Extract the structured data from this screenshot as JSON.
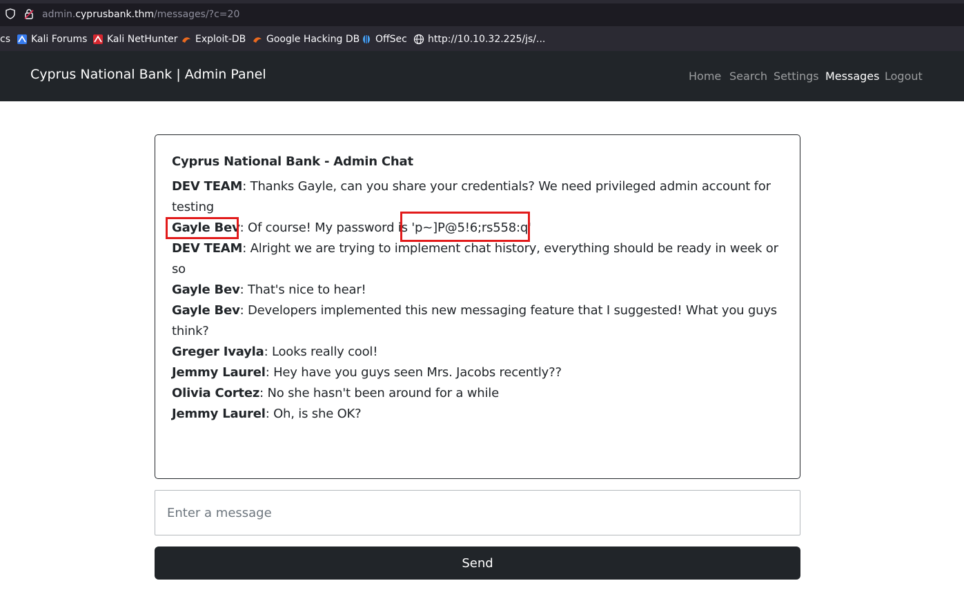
{
  "browser": {
    "url_prefix": "admin.",
    "url_host": "cyprusbank.thm",
    "url_path": "/messages/?c=20",
    "bookmarks": [
      {
        "label": "cs",
        "icon": "none"
      },
      {
        "label": "Kali Forums",
        "icon": "kali-dragon-icon"
      },
      {
        "label": "Kali NetHunter",
        "icon": "nethunter-icon"
      },
      {
        "label": "Exploit-DB",
        "icon": "exploitdb-icon"
      },
      {
        "label": "Google Hacking DB",
        "icon": "ghdb-icon"
      },
      {
        "label": "OffSec",
        "icon": "offsec-icon"
      },
      {
        "label": "http://10.10.32.225/js/...",
        "icon": "globe-icon"
      }
    ]
  },
  "navbar": {
    "brand": "Cyprus National Bank | Admin Panel",
    "links": [
      {
        "label": "Home",
        "active": false
      },
      {
        "label": "Search",
        "active": false
      },
      {
        "label": "Settings",
        "active": false
      },
      {
        "label": "Messages",
        "active": true
      },
      {
        "label": "Logout",
        "active": false
      }
    ]
  },
  "chat": {
    "title": "Cyprus National Bank - Admin Chat",
    "messages": [
      {
        "author": "DEV TEAM",
        "text": ": Thanks Gayle, can you share your credentials? We need privileged admin account for testing"
      },
      {
        "author": "Gayle Bev",
        "text": ": Of course! My password is 'p~]P@5!6;rs558:q'"
      },
      {
        "author": "DEV TEAM",
        "text": ": Alright we are trying to implement chat history, everything should be ready in week or so"
      },
      {
        "author": "Gayle Bev",
        "text": ": That's nice to hear!"
      },
      {
        "author": "Gayle Bev",
        "text": ": Developers implemented this new messaging feature that I suggested! What you guys think?"
      },
      {
        "author": "Greger Ivayla",
        "text": ": Looks really cool!"
      },
      {
        "author": "Jemmy Laurel",
        "text": ": Hey have you guys seen Mrs. Jacobs recently??"
      },
      {
        "author": "Olivia Cortez",
        "text": ": No she hasn't been around for a while"
      },
      {
        "author": "Jemmy Laurel",
        "text": ": Oh, is she OK?"
      }
    ]
  },
  "form": {
    "placeholder": "Enter a message",
    "send_label": "Send"
  },
  "colors": {
    "navbar_bg": "#212529",
    "highlight": "#e21b1b",
    "button_bg": "#212529"
  }
}
